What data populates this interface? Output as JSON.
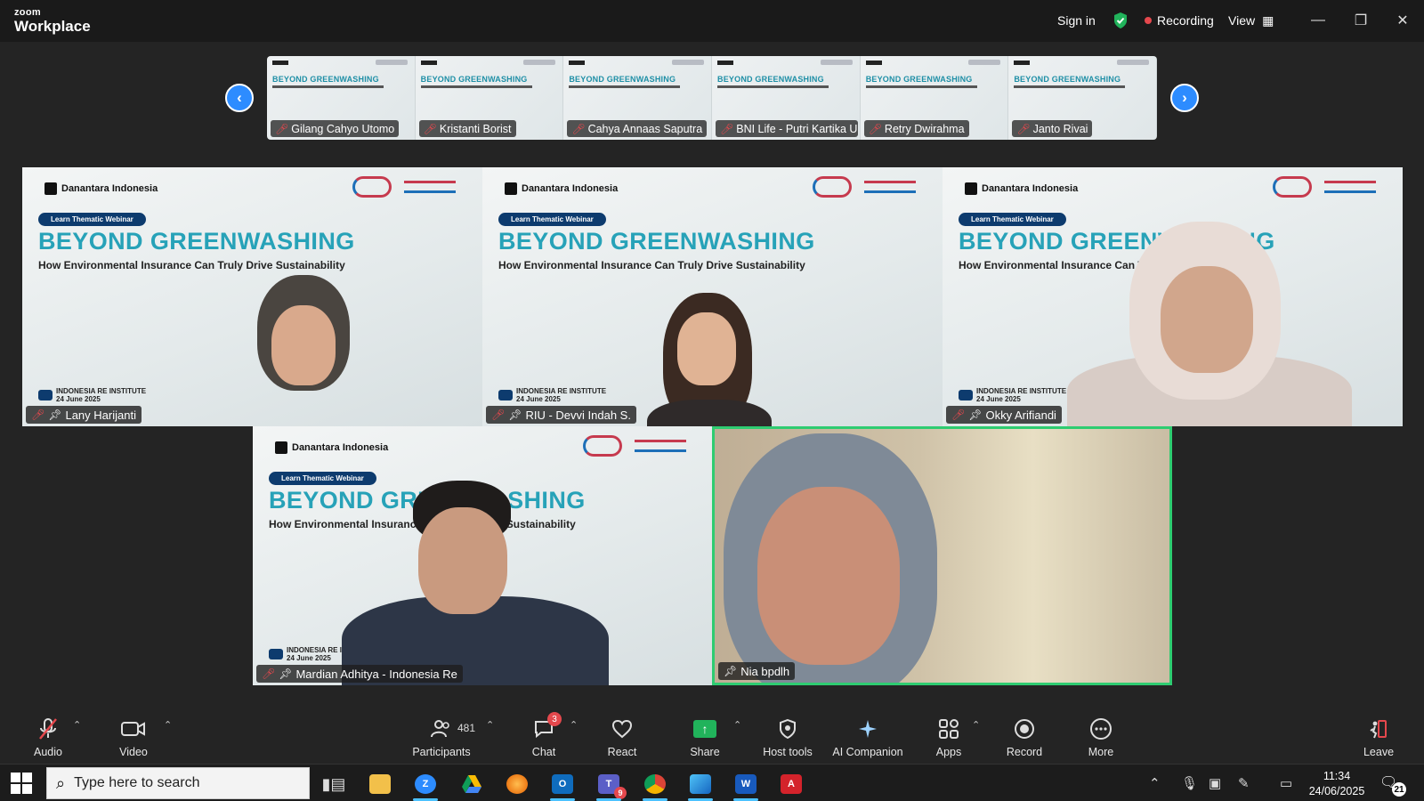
{
  "app": {
    "brand_top": "zoom",
    "brand_bottom": "Workplace"
  },
  "titlebar": {
    "sign_in": "Sign in",
    "recording": "Recording",
    "view": "View"
  },
  "slide": {
    "brand": "Danantara Indonesia",
    "badge": "Learn Thematic Webinar",
    "title": "BEYOND GREENWASHING",
    "subtitle": "How Environmental Insurance Can Truly Drive Sustainability",
    "institute": "INDONESIA RE INSTITUTE",
    "date": "24 June 2025"
  },
  "strip": {
    "thumb_title": "BEYOND GREENWASHING",
    "participants": [
      "Gilang Cahyo Utomo",
      "Kristanti Borist",
      "Cahya Annaas Saputra",
      "BNI Life - Putri Kartika U.",
      "Retry Dwirahma",
      "Janto Rivai"
    ]
  },
  "tiles": [
    {
      "name": "Lany Harijanti"
    },
    {
      "name": "RIU - Devvi Indah S."
    },
    {
      "name": "Okky Arifiandi"
    },
    {
      "name": "Mardian Adhitya - Indonesia Re"
    },
    {
      "name": "Nia bpdlh"
    }
  ],
  "toolbar": {
    "audio": "Audio",
    "video": "Video",
    "participants": "Participants",
    "participants_count": "481",
    "chat": "Chat",
    "chat_badge": "3",
    "react": "React",
    "share": "Share",
    "host_tools": "Host tools",
    "ai_companion": "AI Companion",
    "apps": "Apps",
    "record": "Record",
    "more": "More",
    "leave": "Leave"
  },
  "taskbar": {
    "search_placeholder": "Type here to search",
    "teams_badge": "9",
    "time": "11:34",
    "date": "24/06/2025",
    "notifications": "21"
  },
  "colors": {
    "accent": "#2d8cff",
    "active_speaker": "#2ecc71",
    "slide_title": "#27a2b8",
    "recording_dot": "#e5484d"
  }
}
